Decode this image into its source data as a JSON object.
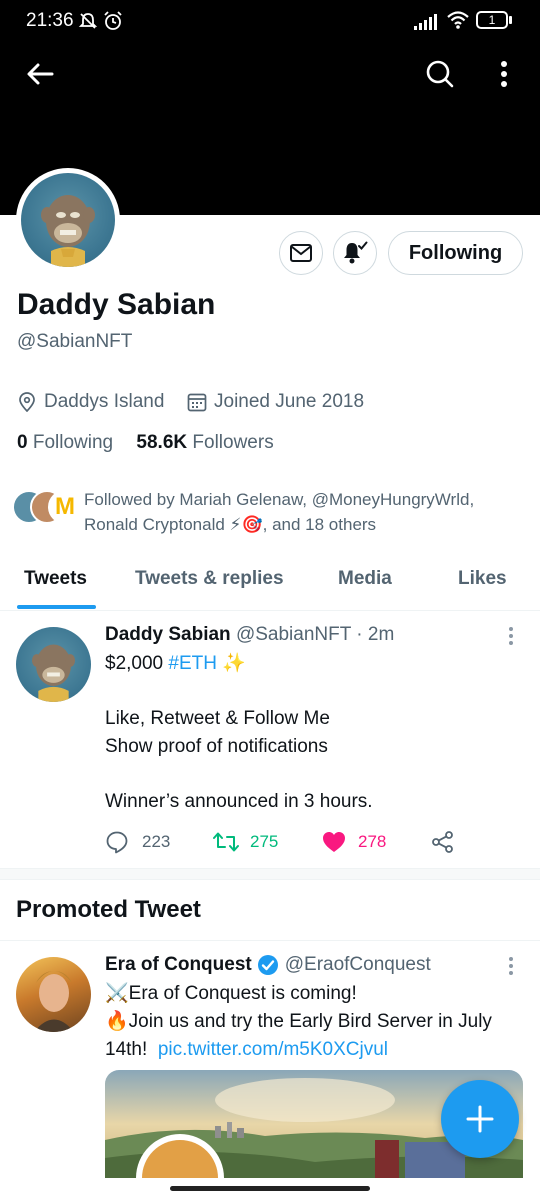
{
  "status": {
    "time": "21:36",
    "battery": "1"
  },
  "profile": {
    "name": "Daddy Sabian",
    "handle": "@SabianNFT",
    "location": "Daddys Island",
    "joined": "Joined June 2018",
    "following_count": "0",
    "following_label": "Following",
    "followers_count": "58.6K",
    "followers_label": "Followers",
    "followed_by_line1": "Followed by Mariah Gelenaw, @MoneyHungryWrld,",
    "followed_by_line2_a": "Ronald Cryptonald ⚡🎯",
    "followed_by_line2_b": ", and 18 others",
    "follow_button_label": "Following"
  },
  "tabs": [
    {
      "label": "Tweets",
      "active": true
    },
    {
      "label": "Tweets & replies",
      "active": false
    },
    {
      "label": "Media",
      "active": false
    },
    {
      "label": "Likes",
      "active": false
    }
  ],
  "tweet": {
    "author_name": "Daddy Sabian",
    "author_handle": "@SabianNFT",
    "time_ago": "· 2m",
    "line1_prefix": "$2,000 ",
    "line1_hashtag": "#ETH",
    "line1_emoji": " ✨",
    "line2": "Like, Retweet & Follow Me",
    "line3": "Show proof of notifications",
    "line4": "Winner’s announced in 3 hours.",
    "replies": "223",
    "retweets": "275",
    "likes": "278"
  },
  "promoted": {
    "section_title": "Promoted Tweet",
    "author_name": "Era of Conquest",
    "author_handle": "@EraofConquest",
    "line1": "⚔️Era of Conquest is coming!",
    "line2": "🔥Join us and try the Early Bird Server in July",
    "line3_prefix": "14th!",
    "line3_link": "pic.twitter.com/m5K0XCjvul"
  },
  "colors": {
    "accent": "#1d9bf0",
    "retweet": "#00ba7c",
    "like": "#f91880"
  }
}
